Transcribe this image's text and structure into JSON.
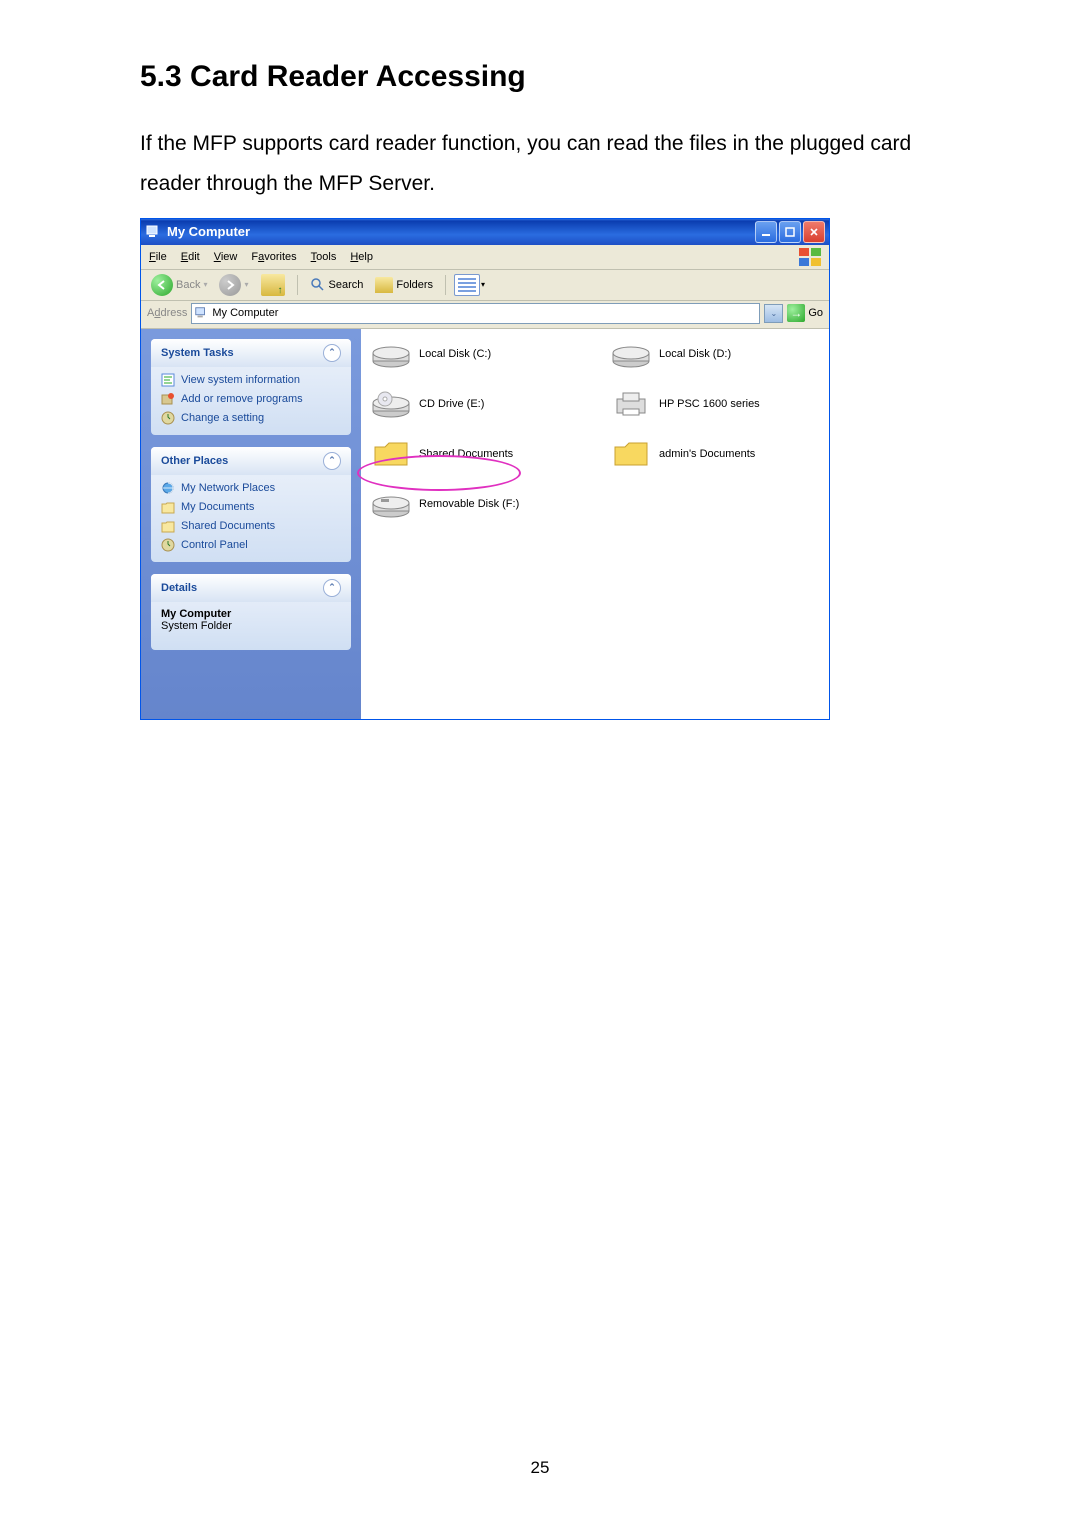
{
  "heading": "5.3    Card Reader Accessing",
  "body": "If the MFP supports card reader function, you can read the files in the plugged card reader through the MFP Server.",
  "window": {
    "title": "My Computer",
    "menus": {
      "file": "File",
      "edit": "Edit",
      "view": "View",
      "favorites": "Favorites",
      "tools": "Tools",
      "help": "Help"
    },
    "toolbar": {
      "back": "Back",
      "search": "Search",
      "folders": "Folders"
    },
    "address": {
      "label": "Address",
      "value": "My Computer",
      "go": "Go"
    },
    "sidebar": {
      "system": {
        "title": "System Tasks",
        "view_info": "View system information",
        "add_remove": "Add or remove programs",
        "change": "Change a setting"
      },
      "other": {
        "title": "Other Places",
        "network": "My Network Places",
        "mydocs": "My Documents",
        "shared": "Shared Documents",
        "cpanel": "Control Panel"
      },
      "details": {
        "title": "Details",
        "name": "My Computer",
        "type": "System Folder"
      }
    },
    "drives": {
      "c": "Local Disk (C:)",
      "d": "Local Disk (D:)",
      "e": "CD Drive (E:)",
      "hp": "HP PSC 1600 series",
      "shared": "Shared Documents",
      "admin": "admin's Documents",
      "f": "Removable Disk (F:)"
    }
  },
  "pagenum": "25"
}
